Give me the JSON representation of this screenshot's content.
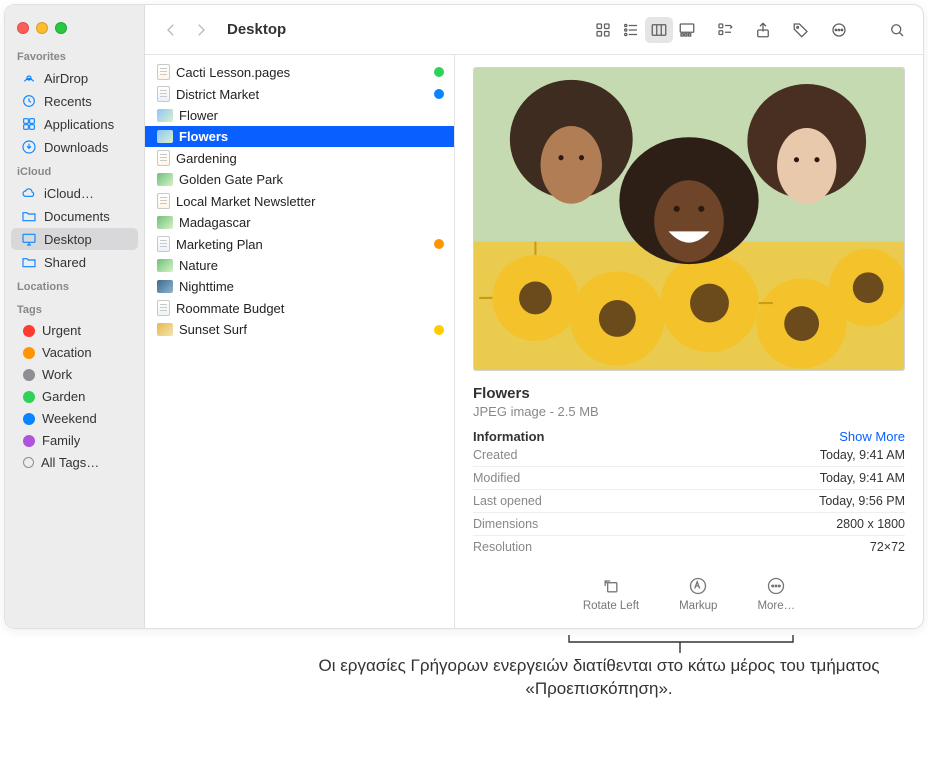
{
  "window": {
    "title": "Desktop"
  },
  "sidebar": {
    "sections": [
      {
        "header": "Favorites",
        "items": [
          {
            "label": "AirDrop",
            "icon": "airdrop"
          },
          {
            "label": "Recents",
            "icon": "recents"
          },
          {
            "label": "Applications",
            "icon": "apps"
          },
          {
            "label": "Downloads",
            "icon": "downloads"
          }
        ]
      },
      {
        "header": "iCloud",
        "items": [
          {
            "label": "iCloud…",
            "icon": "cloud"
          },
          {
            "label": "Documents",
            "icon": "docfolder"
          },
          {
            "label": "Desktop",
            "icon": "desktop",
            "selected": true
          },
          {
            "label": "Shared",
            "icon": "shared"
          }
        ]
      },
      {
        "header": "Locations",
        "items": []
      },
      {
        "header": "Tags",
        "items": [
          {
            "label": "Urgent",
            "tagcolor": "red"
          },
          {
            "label": "Vacation",
            "tagcolor": "orange"
          },
          {
            "label": "Work",
            "tagcolor": "grey"
          },
          {
            "label": "Garden",
            "tagcolor": "green"
          },
          {
            "label": "Weekend",
            "tagcolor": "blue"
          },
          {
            "label": "Family",
            "tagcolor": "purple"
          },
          {
            "label": "All Tags…",
            "alltags": true
          }
        ]
      }
    ]
  },
  "files": [
    {
      "name": "Cacti Lesson.pages",
      "kind": "pages",
      "tag": "green"
    },
    {
      "name": "District Market",
      "kind": "key",
      "tag": "blue"
    },
    {
      "name": "Flower",
      "kind": "jpg"
    },
    {
      "name": "Flowers",
      "kind": "jpg",
      "selected": true
    },
    {
      "name": "Gardening",
      "kind": "pages"
    },
    {
      "name": "Golden Gate Park",
      "kind": "jpg3"
    },
    {
      "name": "Local Market Newsletter",
      "kind": "pages"
    },
    {
      "name": "Madagascar",
      "kind": "jpg3"
    },
    {
      "name": "Marketing Plan",
      "kind": "key",
      "tag": "orange"
    },
    {
      "name": "Nature",
      "kind": "jpg3"
    },
    {
      "name": "Nighttime",
      "kind": "jpg4"
    },
    {
      "name": "Roommate Budget",
      "kind": "numbers"
    },
    {
      "name": "Sunset Surf",
      "kind": "jpg5",
      "tag": "yellow"
    }
  ],
  "preview": {
    "title": "Flowers",
    "subtitle": "JPEG image - 2.5 MB",
    "info_header": "Information",
    "show_more": "Show More",
    "rows": [
      {
        "k": "Created",
        "v": "Today, 9:41 AM"
      },
      {
        "k": "Modified",
        "v": "Today, 9:41 AM"
      },
      {
        "k": "Last opened",
        "v": "Today, 9:56 PM"
      },
      {
        "k": "Dimensions",
        "v": "2800 x 1800"
      },
      {
        "k": "Resolution",
        "v": "72×72"
      }
    ],
    "actions": [
      {
        "label": "Rotate Left",
        "icon": "rotate"
      },
      {
        "label": "Markup",
        "icon": "markup"
      },
      {
        "label": "More…",
        "icon": "more"
      }
    ]
  },
  "caption": "Οι εργασίες Γρήγορων ενεργειών διατίθενται στο κάτω μέρος του τμήματος «Προεπισκόπηση»."
}
